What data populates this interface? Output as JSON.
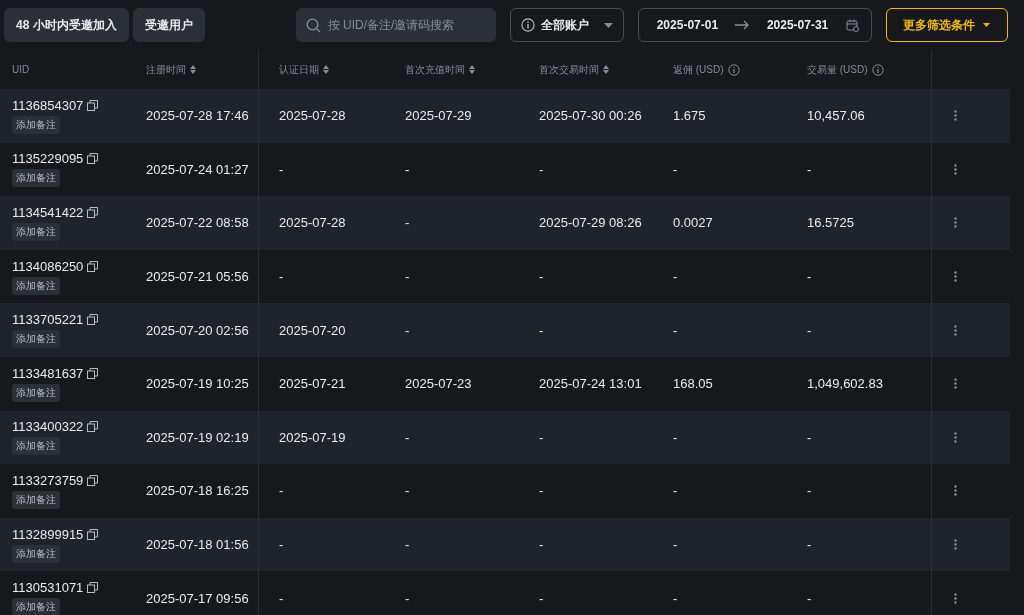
{
  "tabs": [
    {
      "label": "48 小时内受邀加入",
      "selected": false
    },
    {
      "label": "受邀用户",
      "selected": false
    }
  ],
  "search": {
    "placeholder": "按 UID/备注/邀请码搜索"
  },
  "account_filter": {
    "value": "全部账户"
  },
  "date_range": {
    "start": "2025-07-01",
    "end": "2025-07-31"
  },
  "more_filters": {
    "label": "更多筛选条件"
  },
  "table": {
    "columns": [
      {
        "label": "UID",
        "sortable": false,
        "info": false
      },
      {
        "label": "注册时间",
        "sortable": true,
        "info": false
      },
      {
        "label": "认证日期",
        "sortable": true,
        "info": false
      },
      {
        "label": "首次充值时间",
        "sortable": true,
        "info": false
      },
      {
        "label": "首次交易时间",
        "sortable": true,
        "info": false
      },
      {
        "label": "返佣 (USD)",
        "sortable": false,
        "info": true
      },
      {
        "label": "交易量 (USD)",
        "sortable": false,
        "info": true
      }
    ],
    "rows": [
      {
        "note": "添加备注",
        "cells": [
          "1136854307",
          "2025-07-28 17:46",
          "2025-07-28",
          "2025-07-29",
          "2025-07-30 00:26",
          "1.675",
          "10,457.06"
        ]
      },
      {
        "note": "添加备注",
        "cells": [
          "1135229095",
          "2025-07-24 01:27",
          "-",
          "-",
          "-",
          "-",
          "-"
        ]
      },
      {
        "note": "添加备注",
        "cells": [
          "1134541422",
          "2025-07-22 08:58",
          "2025-07-28",
          "-",
          "2025-07-29 08:26",
          "0.0027",
          "16.5725"
        ]
      },
      {
        "note": "添加备注",
        "cells": [
          "1134086250",
          "2025-07-21 05:56",
          "-",
          "-",
          "-",
          "-",
          "-"
        ]
      },
      {
        "note": "添加备注",
        "cells": [
          "1133705221",
          "2025-07-20 02:56",
          "2025-07-20",
          "-",
          "-",
          "-",
          "-"
        ]
      },
      {
        "note": "添加备注",
        "cells": [
          "1133481637",
          "2025-07-19 10:25",
          "2025-07-21",
          "2025-07-23",
          "2025-07-24 13:01",
          "168.05",
          "1,049,602.83"
        ]
      },
      {
        "note": "添加备注",
        "cells": [
          "1133400322",
          "2025-07-19 02:19",
          "2025-07-19",
          "-",
          "-",
          "-",
          "-"
        ]
      },
      {
        "note": "添加备注",
        "cells": [
          "1133273759",
          "2025-07-18 16:25",
          "-",
          "-",
          "-",
          "-",
          "-"
        ]
      },
      {
        "note": "添加备注",
        "cells": [
          "1132899915",
          "2025-07-18 01:56",
          "-",
          "-",
          "-",
          "-",
          "-"
        ]
      },
      {
        "note": "添加备注",
        "cells": [
          "1130531071",
          "2025-07-17 09:56",
          "-",
          "-",
          "-",
          "-",
          "-"
        ]
      }
    ]
  }
}
